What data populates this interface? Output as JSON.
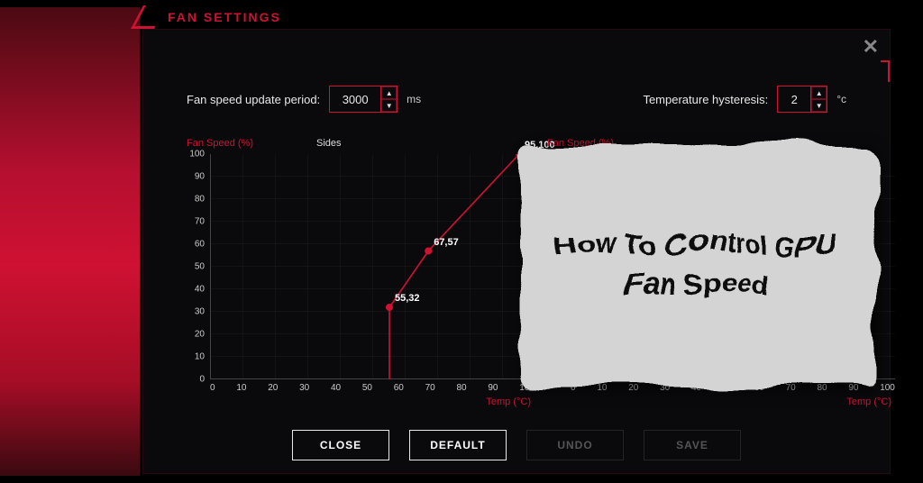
{
  "window": {
    "title": "FAN SETTINGS"
  },
  "fields": {
    "update_period": {
      "label": "Fan speed update period:",
      "value": "3000",
      "unit": "ms"
    },
    "hysteresis": {
      "label": "Temperature hysteresis:",
      "value": "2",
      "unit": "°c"
    }
  },
  "chart_data": [
    {
      "type": "line",
      "title": "Sides",
      "ylabel": "Fan Speed (%)",
      "xlabel": "Temp (°C)",
      "xlim": [
        0,
        100
      ],
      "ylim": [
        0,
        100
      ],
      "xticks": [
        0,
        10,
        20,
        30,
        40,
        50,
        60,
        70,
        80,
        90,
        100
      ],
      "yticks": [
        0,
        10,
        20,
        30,
        40,
        50,
        60,
        70,
        80,
        90,
        100
      ],
      "series": [
        {
          "name": "curve",
          "color": "#cf1133",
          "points": [
            {
              "x": 55,
              "y": 32,
              "label": "55,32"
            },
            {
              "x": 67,
              "y": 57,
              "label": "67,57"
            },
            {
              "x": 95,
              "y": 100,
              "label": "95,100"
            }
          ]
        }
      ]
    },
    {
      "type": "line",
      "title": "",
      "ylabel": "Fan Speed (%)",
      "xlabel": "Temp (°C)",
      "xlim": [
        0,
        100
      ],
      "ylim": [
        0,
        100
      ],
      "xticks": [
        0,
        10,
        20,
        30,
        40,
        50,
        60,
        70,
        80,
        90,
        100
      ],
      "yticks": [
        0,
        10,
        20,
        30,
        40,
        50,
        60,
        70,
        80,
        90,
        100
      ],
      "series": [
        {
          "name": "curve",
          "color": "#cf1133",
          "points": []
        }
      ]
    }
  ],
  "buttons": {
    "close": "CLOSE",
    "default": "DEFAULT",
    "undo": "UNDO",
    "save": "SAVE"
  },
  "overlay": {
    "text": "How To Control GPU Fan Speed"
  },
  "colors": {
    "accent": "#cf1133",
    "bg": "#0a0a0c"
  }
}
